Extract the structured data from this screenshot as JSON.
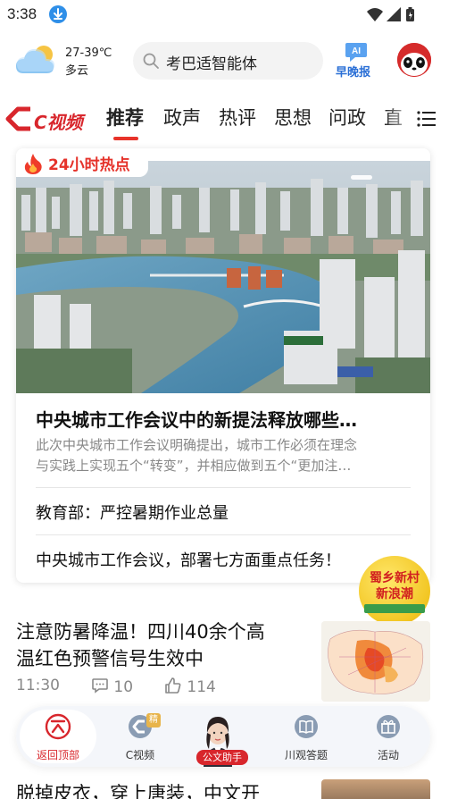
{
  "status_bar": {
    "time": "3:38"
  },
  "header": {
    "weather": {
      "temperature": "27-39℃",
      "condition": "多云"
    },
    "search": {
      "query": "考巴适智能体"
    },
    "ai_news": {
      "label": "早晚报",
      "icon_text": "AI"
    }
  },
  "nav": {
    "logo_text": "C视频",
    "tabs": [
      {
        "label": "推荐",
        "active": true
      },
      {
        "label": "政声"
      },
      {
        "label": "热评"
      },
      {
        "label": "思想"
      },
      {
        "label": "问政"
      },
      {
        "label": "直"
      }
    ],
    "accent_color": "#e8332a"
  },
  "hot_card": {
    "tag": "24小时热点",
    "title": "中央城市工作会议中的新提法释放哪些…",
    "summary_lines": [
      "此次中央城市工作会议明确提出，城市工作必须在理念",
      "与实践上实现五个“转变”，并相应做到五个“更加注…"
    ],
    "items": [
      "教育部：严控暑期作业总量",
      "中央城市工作会议，部署七方面重点任务！"
    ]
  },
  "promo": {
    "line1": "蜀乡新村",
    "line2": "新浪潮"
  },
  "news": {
    "title_lines": [
      "注意防暑降温！四川40余个高",
      "温红色预警信号生效中"
    ],
    "time": "11:30",
    "comments": "10",
    "likes": "114"
  },
  "bottom_bar": {
    "items": [
      {
        "label": "返回顶部",
        "active": true
      },
      {
        "label": "C视频",
        "badge": "精"
      },
      {
        "label": "公文助手"
      },
      {
        "label": "川观答题"
      },
      {
        "label": "活动"
      }
    ]
  },
  "next_news": {
    "title": "脱掉皮衣，穿上唐装，中文开"
  }
}
